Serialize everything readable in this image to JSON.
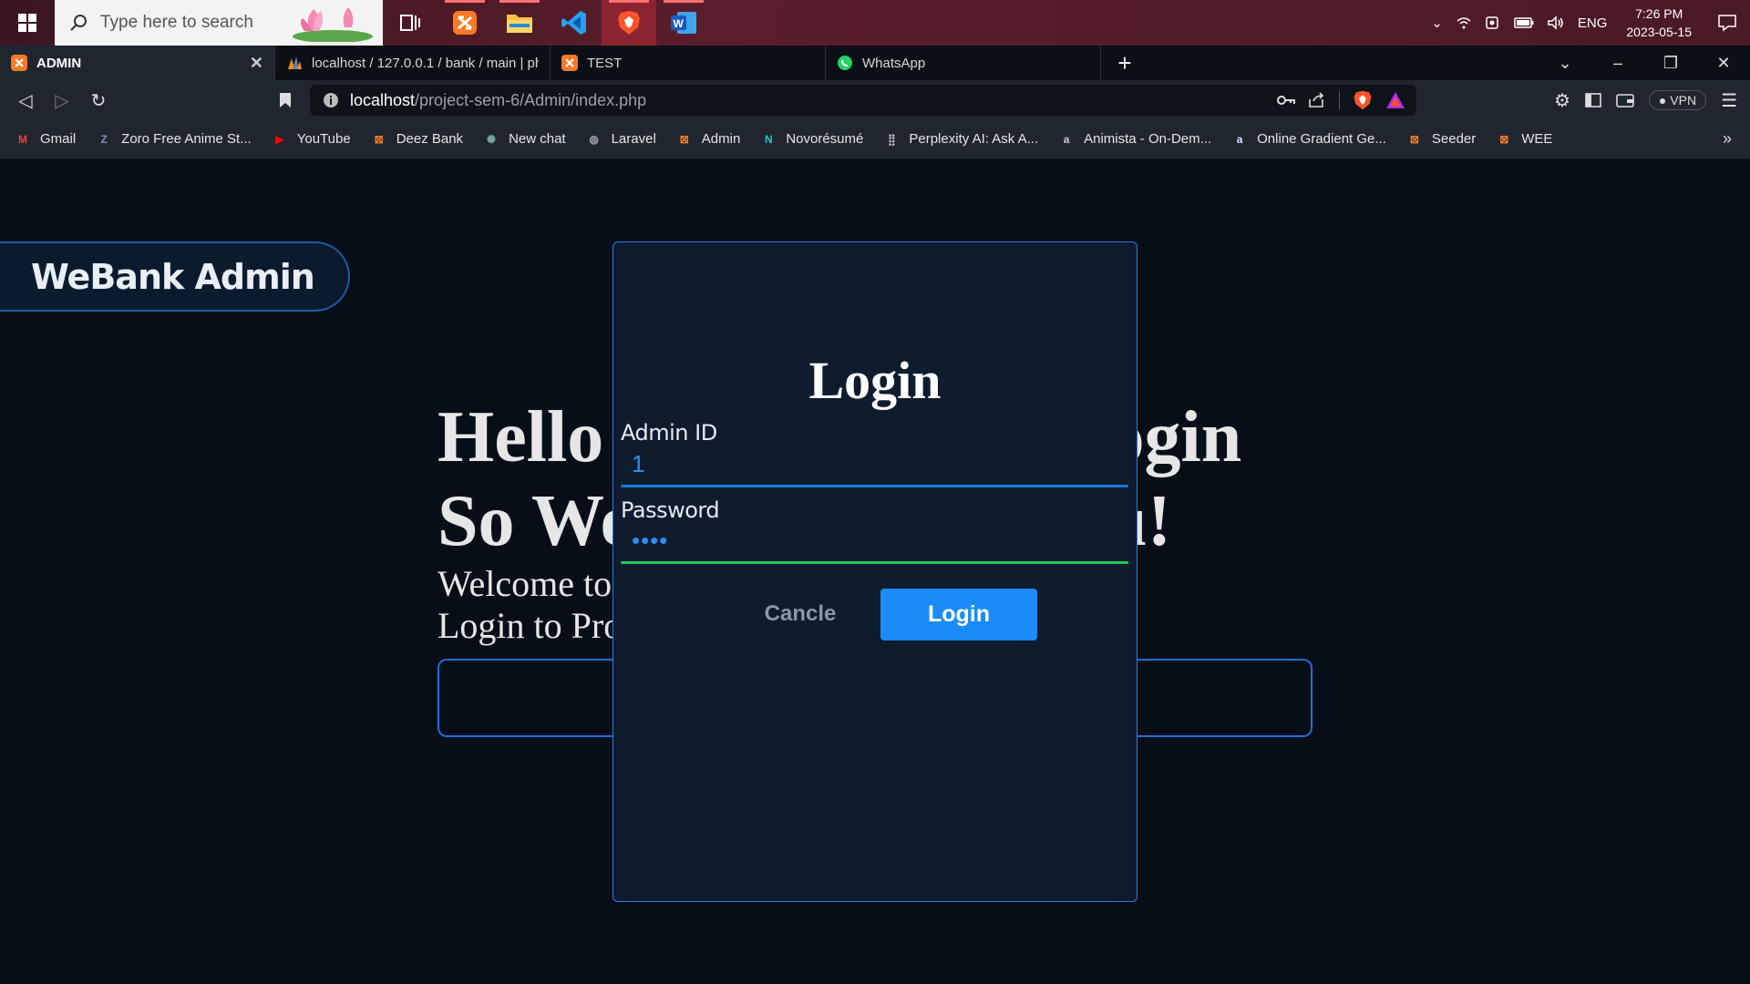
{
  "taskbar": {
    "search_placeholder": "Type here to search",
    "language": "ENG",
    "time": "7:26 PM",
    "date": "2023-05-15",
    "apps": [
      "task-view",
      "xampp",
      "file-explorer",
      "vscode",
      "brave",
      "word"
    ]
  },
  "browser": {
    "tabs": [
      {
        "label": "ADMIN",
        "icon": "xampp-icon",
        "active": true
      },
      {
        "label": "localhost / 127.0.0.1 / bank / main | ph",
        "icon": "phpmyadmin-icon"
      },
      {
        "label": "TEST",
        "icon": "xampp-icon"
      },
      {
        "label": "WhatsApp",
        "icon": "whatsapp-icon"
      }
    ],
    "url_host": "localhost",
    "url_path": "/project-sem-6/Admin/index.php",
    "vpn_label": "VPN",
    "bookmarks": [
      {
        "label": "Gmail",
        "icon": "gmail-icon",
        "color": "#ea4335",
        "glyph": "M"
      },
      {
        "label": "Zoro Free Anime St...",
        "icon": "zoro-icon",
        "color": "#8a8fb0",
        "glyph": "Z"
      },
      {
        "label": "YouTube",
        "icon": "youtube-icon",
        "color": "#ff0000",
        "glyph": "▶"
      },
      {
        "label": "Deez Bank",
        "icon": "xampp-icon",
        "color": "#fb7a24",
        "glyph": "⊠"
      },
      {
        "label": "New chat",
        "icon": "chatgpt-icon",
        "color": "#74aa9c",
        "glyph": "✺"
      },
      {
        "label": "Laravel",
        "icon": "globe-icon",
        "color": "#9aa0a6",
        "glyph": "◍"
      },
      {
        "label": "Admin",
        "icon": "xampp-icon",
        "color": "#fb7a24",
        "glyph": "⊠"
      },
      {
        "label": "Novorésumé",
        "icon": "novoresume-icon",
        "color": "#1fc7b8",
        "glyph": "N"
      },
      {
        "label": "Perplexity AI: Ask A...",
        "icon": "perplexity-icon",
        "color": "#cccccc",
        "glyph": "⣿"
      },
      {
        "label": "Animista - On-Dem...",
        "icon": "animista-icon",
        "color": "#cccccc",
        "glyph": "a"
      },
      {
        "label": "Online Gradient Ge...",
        "icon": "gradient-icon",
        "color": "#dfe3ff",
        "glyph": "a"
      },
      {
        "label": "Seeder",
        "icon": "xampp-icon",
        "color": "#fb7a24",
        "glyph": "⊠"
      },
      {
        "label": "WEE",
        "icon": "xampp-icon",
        "color": "#fb7a24",
        "glyph": "⊠"
      }
    ]
  },
  "page": {
    "brand": "WeBank Admin",
    "hero_line1": "Hello                         Login",
    "hero_line2": "So We                        ou!",
    "hero_sub1": "Welcome to",
    "hero_sub2": "Login to Pro"
  },
  "login_modal": {
    "title": "Login",
    "admin_id_label": "Admin ID",
    "admin_id_value": "1",
    "password_label": "Password",
    "password_value": "••••",
    "cancel_label": "Cancle",
    "login_label": "Login"
  },
  "colors": {
    "accent_blue": "#1b8cf7",
    "admin_underline": "#1e78e0",
    "password_underline": "#22c55e",
    "page_bg": "#070e18",
    "modal_bg": "#0f1c2e"
  }
}
